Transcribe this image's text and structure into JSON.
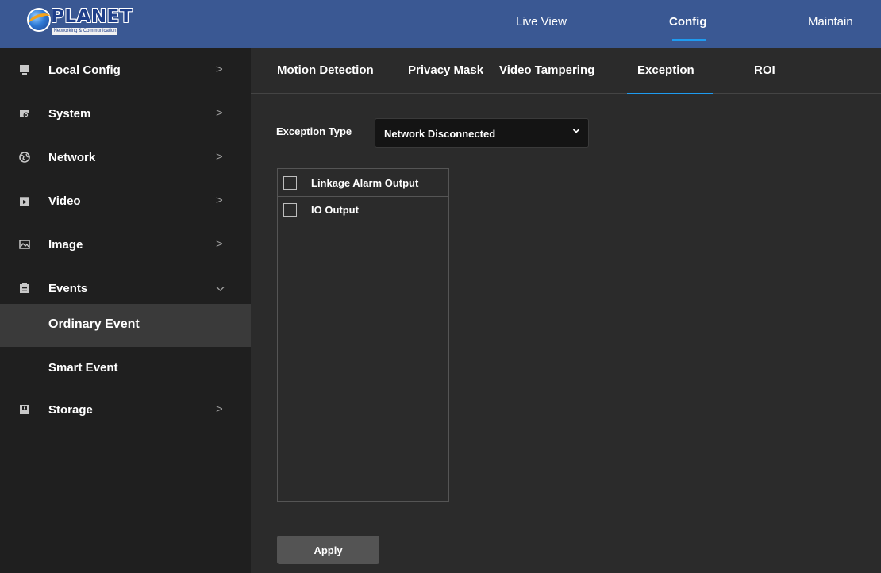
{
  "header": {
    "logo_text": "PLANET",
    "logo_subtext": "Networking & Communication",
    "nav": [
      {
        "label": "Live View",
        "active": false
      },
      {
        "label": "Config",
        "active": true
      },
      {
        "label": "Maintain",
        "active": false
      }
    ]
  },
  "sidebar": {
    "items": [
      {
        "label": "Local Config",
        "icon": "monitor-icon",
        "chevron": ">"
      },
      {
        "label": "System",
        "icon": "system-icon",
        "chevron": ">"
      },
      {
        "label": "Network",
        "icon": "network-globe-icon",
        "chevron": ">"
      },
      {
        "label": "Video",
        "icon": "video-icon",
        "chevron": ">"
      },
      {
        "label": "Image",
        "icon": "image-icon",
        "chevron": ">"
      },
      {
        "label": "Events",
        "icon": "events-clipboard-icon",
        "chevron": "v",
        "expanded": true
      },
      {
        "label": "Storage",
        "icon": "storage-icon",
        "chevron": ">"
      }
    ],
    "events_sub": [
      {
        "label": "Ordinary Event",
        "selected": true
      },
      {
        "label": "Smart Event",
        "selected": false
      }
    ]
  },
  "main": {
    "tabs": [
      {
        "label": "Motion Detection",
        "active": false
      },
      {
        "label": "Privacy Mask",
        "active": false
      },
      {
        "label": "Video Tampering",
        "active": false
      },
      {
        "label": "Exception",
        "active": true
      },
      {
        "label": "ROI",
        "active": false
      }
    ],
    "exception_type_label": "Exception Type",
    "exception_type_value": "Network Disconnected",
    "linkage": [
      {
        "label": "Linkage Alarm Output",
        "checked": false
      },
      {
        "label": "IO Output",
        "checked": false
      }
    ],
    "apply_label": "Apply"
  },
  "colors": {
    "topbar": "#3a5893",
    "sidebar": "#1f1f1f",
    "content": "#2b2b2b",
    "accent": "#1e9bf0"
  }
}
